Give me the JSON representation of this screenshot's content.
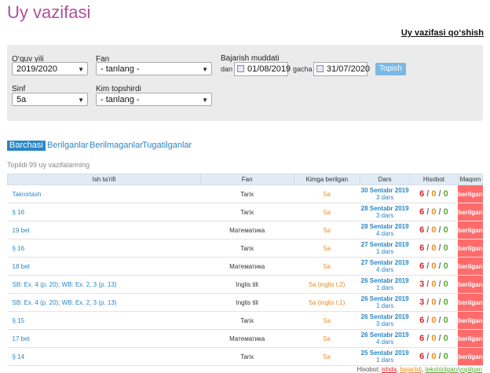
{
  "page": {
    "title": "Uy vazifasi",
    "add_link": "Uy vazifasi qo‘shish"
  },
  "filters": {
    "year_label": "O‘quv yili",
    "year_value": "2019/2020",
    "fan_label": "Fan",
    "fan_value": "- tanlang -",
    "deadline_label": "Bajarish muddati",
    "from_label": "dan",
    "from_value": "01/08/2019",
    "to_label": "gacha",
    "to_value": "31/07/2020",
    "search_button": "Topish",
    "class_label": "Sinf",
    "class_value": "5a",
    "given_by_label": "Kim topshirdi",
    "given_by_value": "- tanlang -"
  },
  "tabs": [
    "Barchasi",
    "Berilganlar",
    "Berilmaganlar",
    "Tugatilganlar"
  ],
  "found_text": "Topildi 99 uy vazifalarining",
  "table": {
    "headers": [
      "Ish ta'rifi",
      "Fan",
      "Kimga berilgan",
      "Dars",
      "Hisobot",
      "Maqom"
    ],
    "rows": [
      {
        "name": "Takrorlash",
        "fan": "Tarix",
        "whom": "5a",
        "date": "30 Sentabr 2019",
        "lessons": "3 dars",
        "r": "6",
        "o": "0",
        "g": "0",
        "status": "berilgan"
      },
      {
        "name": "§ 16",
        "fan": "Tarix",
        "whom": "5a",
        "date": "28 Sentabr 2019",
        "lessons": "3 dars",
        "r": "6",
        "o": "0",
        "g": "0",
        "status": "berilgan"
      },
      {
        "name": "19 bet",
        "fan": "Математика",
        "whom": "5a",
        "date": "28 Sentabr 2019",
        "lessons": "4 dars",
        "r": "6",
        "o": "0",
        "g": "0",
        "status": "berilgan"
      },
      {
        "name": "§ 16",
        "fan": "Tarix",
        "whom": "5a",
        "date": "27 Sentabr 2019",
        "lessons": "1 dars",
        "r": "6",
        "o": "0",
        "g": "0",
        "status": "berilgan"
      },
      {
        "name": "18 bet",
        "fan": "Математика",
        "whom": "5a",
        "date": "27 Sentabr 2019",
        "lessons": "4 dars",
        "r": "6",
        "o": "0",
        "g": "0",
        "status": "berilgan"
      },
      {
        "name": "SB: Ex. 4 (p. 20); WB: Ex. 2, 3 (p. 13)",
        "fan": "Inglis tili",
        "whom": "5a (inglis t.2)",
        "date": "26 Sentabr 2019",
        "lessons": "1 dars",
        "r": "3",
        "o": "0",
        "g": "0",
        "status": "berilgan"
      },
      {
        "name": "SB: Ex. 4 (p. 20); WB: Ex. 2, 3 (p. 13)",
        "fan": "Inglis tili",
        "whom": "5a (inglis t.1)",
        "date": "26 Sentabr 2019",
        "lessons": "1 dars",
        "r": "3",
        "o": "0",
        "g": "0",
        "status": "berilgan"
      },
      {
        "name": "§ 15",
        "fan": "Tarix",
        "whom": "5a",
        "date": "26 Sentabr 2019",
        "lessons": "3 dars",
        "r": "6",
        "o": "0",
        "g": "0",
        "status": "berilgan"
      },
      {
        "name": "17 bet",
        "fan": "Математика",
        "whom": "5a",
        "date": "26 Sentabr 2019",
        "lessons": "4 dars",
        "r": "6",
        "o": "0",
        "g": "0",
        "status": "berilgan"
      },
      {
        "name": "§ 14",
        "fan": "Tarix",
        "whom": "5a",
        "date": "25 Sentabr 2019",
        "lessons": "1 dars",
        "r": "6",
        "o": "0",
        "g": "0",
        "status": "berilgan"
      }
    ]
  },
  "footer": {
    "label": "Hisobot:",
    "k1": "ishda",
    "k2": "bajarildi",
    "k3": "tekshirilgan/yopilgan"
  },
  "colors": {
    "accent": "#2a86c5",
    "title": "#b0509a",
    "status_bg": "#ff6b6b"
  }
}
